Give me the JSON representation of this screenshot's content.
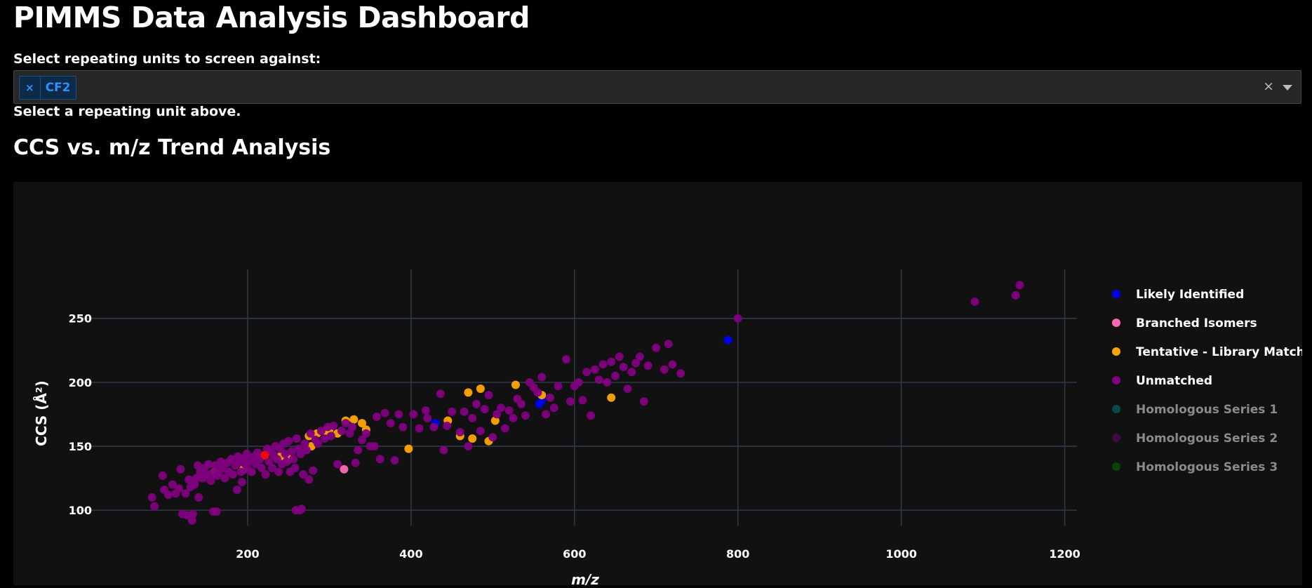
{
  "header": {
    "title": "PIMMS Data Analysis Dashboard",
    "select_label": "Select repeating units to screen against:",
    "selected_chip": "CF2",
    "chip_remove": "×",
    "clear_all": "×",
    "hint": "Select a repeating unit above."
  },
  "section": {
    "title": "CCS vs. m/z Trend Analysis"
  },
  "chart_data": {
    "type": "scatter",
    "title": "",
    "xlabel": "m/z",
    "ylabel": "CCS (Å²)",
    "xlim": [
      30,
      1215
    ],
    "ylim": [
      88,
      280
    ],
    "xticks": [
      200,
      400,
      600,
      800,
      1000,
      1200
    ],
    "yticks": [
      100,
      150,
      200,
      250
    ],
    "grid": true,
    "legend_position": "right",
    "series": [
      {
        "name": "Likely Identified",
        "color": "#0000ee",
        "visible": true,
        "points": [
          [
            430,
            168
          ],
          [
            557,
            183
          ],
          [
            560,
            186
          ],
          [
            788,
            233
          ]
        ]
      },
      {
        "name": "Branched Isomers",
        "color": "#ff69b4",
        "visible": true,
        "points": [
          [
            318,
            132
          ]
        ]
      },
      {
        "name": "Tentative - Library Match",
        "color": "#ffa500",
        "visible": true,
        "points": [
          [
            160,
            130
          ],
          [
            195,
            132
          ],
          [
            240,
            142
          ],
          [
            250,
            140
          ],
          [
            275,
            158
          ],
          [
            278,
            150
          ],
          [
            285,
            160
          ],
          [
            295,
            162
          ],
          [
            300,
            163
          ],
          [
            310,
            160
          ],
          [
            320,
            170
          ],
          [
            330,
            171
          ],
          [
            340,
            168
          ],
          [
            345,
            163
          ],
          [
            397,
            148
          ],
          [
            445,
            170
          ],
          [
            460,
            158
          ],
          [
            470,
            192
          ],
          [
            475,
            156
          ],
          [
            485,
            195
          ],
          [
            495,
            154
          ],
          [
            503,
            170
          ],
          [
            528,
            198
          ],
          [
            560,
            190
          ],
          [
            645,
            188
          ]
        ]
      },
      {
        "name": "Unmatched",
        "color": "#800080",
        "visible": true,
        "points": [
          [
            83,
            110
          ],
          [
            86,
            103
          ],
          [
            96,
            127
          ],
          [
            98,
            116
          ],
          [
            103,
            112
          ],
          [
            108,
            120
          ],
          [
            112,
            113
          ],
          [
            116,
            117
          ],
          [
            118,
            132
          ],
          [
            120,
            97
          ],
          [
            124,
            113
          ],
          [
            126,
            96
          ],
          [
            128,
            124
          ],
          [
            130,
            118
          ],
          [
            132,
            92
          ],
          [
            133,
            97
          ],
          [
            135,
            120
          ],
          [
            137,
            125
          ],
          [
            139,
            135
          ],
          [
            140,
            110
          ],
          [
            142,
            130
          ],
          [
            145,
            125
          ],
          [
            147,
            133
          ],
          [
            150,
            128
          ],
          [
            152,
            136
          ],
          [
            155,
            123
          ],
          [
            157,
            129
          ],
          [
            158,
            99
          ],
          [
            160,
            135
          ],
          [
            162,
            99
          ],
          [
            163,
            127
          ],
          [
            165,
            130
          ],
          [
            167,
            138
          ],
          [
            170,
            133
          ],
          [
            172,
            125
          ],
          [
            175,
            137
          ],
          [
            177,
            130
          ],
          [
            180,
            140
          ],
          [
            182,
            128
          ],
          [
            185,
            135
          ],
          [
            187,
            116
          ],
          [
            188,
            142
          ],
          [
            190,
            138
          ],
          [
            192,
            130
          ],
          [
            193,
            122
          ],
          [
            195,
            140
          ],
          [
            197,
            136
          ],
          [
            199,
            144
          ],
          [
            200,
            132
          ],
          [
            202,
            138
          ],
          [
            205,
            130
          ],
          [
            208,
            142
          ],
          [
            210,
            136
          ],
          [
            212,
            145
          ],
          [
            215,
            140
          ],
          [
            217,
            133
          ],
          [
            220,
            143
          ],
          [
            222,
            128
          ],
          [
            224,
            148
          ],
          [
            226,
            138
          ],
          [
            228,
            146
          ],
          [
            230,
            133
          ],
          [
            232,
            143
          ],
          [
            234,
            150
          ],
          [
            236,
            140
          ],
          [
            238,
            130
          ],
          [
            240,
            148
          ],
          [
            242,
            136
          ],
          [
            244,
            152
          ],
          [
            246,
            144
          ],
          [
            248,
            138
          ],
          [
            250,
            154
          ],
          [
            252,
            130
          ],
          [
            254,
            146
          ],
          [
            256,
            140
          ],
          [
            258,
            133
          ],
          [
            259,
            100
          ],
          [
            260,
            156
          ],
          [
            262,
            148
          ],
          [
            264,
            100
          ],
          [
            265,
            144
          ],
          [
            266,
            101
          ],
          [
            268,
            128
          ],
          [
            270,
            152
          ],
          [
            272,
            147
          ],
          [
            275,
            124
          ],
          [
            277,
            160
          ],
          [
            280,
            131
          ],
          [
            283,
            155
          ],
          [
            286,
            152
          ],
          [
            290,
            162
          ],
          [
            294,
            156
          ],
          [
            298,
            165
          ],
          [
            302,
            158
          ],
          [
            305,
            166
          ],
          [
            310,
            136
          ],
          [
            315,
            162
          ],
          [
            320,
            168
          ],
          [
            325,
            160
          ],
          [
            328,
            165
          ],
          [
            332,
            137
          ],
          [
            335,
            147
          ],
          [
            340,
            155
          ],
          [
            345,
            160
          ],
          [
            350,
            150
          ],
          [
            355,
            150
          ],
          [
            358,
            173
          ],
          [
            362,
            140
          ],
          [
            368,
            176
          ],
          [
            375,
            168
          ],
          [
            380,
            139
          ],
          [
            385,
            175
          ],
          [
            390,
            165
          ],
          [
            403,
            175
          ],
          [
            410,
            164
          ],
          [
            418,
            178
          ],
          [
            420,
            172
          ],
          [
            428,
            165
          ],
          [
            436,
            191
          ],
          [
            440,
            147
          ],
          [
            444,
            166
          ],
          [
            450,
            177
          ],
          [
            460,
            161
          ],
          [
            465,
            177
          ],
          [
            470,
            150
          ],
          [
            475,
            172
          ],
          [
            480,
            183
          ],
          [
            485,
            162
          ],
          [
            490,
            179
          ],
          [
            495,
            190
          ],
          [
            500,
            157
          ],
          [
            505,
            175
          ],
          [
            510,
            180
          ],
          [
            515,
            164
          ],
          [
            520,
            178
          ],
          [
            525,
            172
          ],
          [
            530,
            187
          ],
          [
            535,
            183
          ],
          [
            540,
            174
          ],
          [
            545,
            200
          ],
          [
            550,
            196
          ],
          [
            555,
            192
          ],
          [
            560,
            204
          ],
          [
            565,
            175
          ],
          [
            570,
            188
          ],
          [
            575,
            180
          ],
          [
            580,
            197
          ],
          [
            590,
            218
          ],
          [
            595,
            185
          ],
          [
            600,
            197
          ],
          [
            605,
            200
          ],
          [
            610,
            186
          ],
          [
            615,
            208
          ],
          [
            620,
            174
          ],
          [
            625,
            210
          ],
          [
            630,
            202
          ],
          [
            635,
            214
          ],
          [
            640,
            200
          ],
          [
            645,
            216
          ],
          [
            650,
            205
          ],
          [
            655,
            220
          ],
          [
            660,
            212
          ],
          [
            665,
            195
          ],
          [
            670,
            208
          ],
          [
            675,
            215
          ],
          [
            680,
            220
          ],
          [
            685,
            185
          ],
          [
            690,
            213
          ],
          [
            700,
            227
          ],
          [
            710,
            210
          ],
          [
            715,
            230
          ],
          [
            720,
            214
          ],
          [
            730,
            207
          ],
          [
            800,
            250
          ],
          [
            1090,
            263
          ],
          [
            1140,
            268
          ],
          [
            1145,
            276
          ]
        ]
      },
      {
        "name": "Homologous Series 1",
        "color": "#008b8b",
        "visible": false,
        "points": []
      },
      {
        "name": "Homologous Series 2",
        "color": "#800080",
        "visible": false,
        "points": []
      },
      {
        "name": "Homologous Series 3",
        "color": "#008000",
        "visible": false,
        "points": []
      },
      {
        "name": "",
        "color": "#ff0000",
        "visible": true,
        "hide_in_legend": true,
        "points": [
          [
            221,
            143
          ]
        ]
      }
    ]
  }
}
